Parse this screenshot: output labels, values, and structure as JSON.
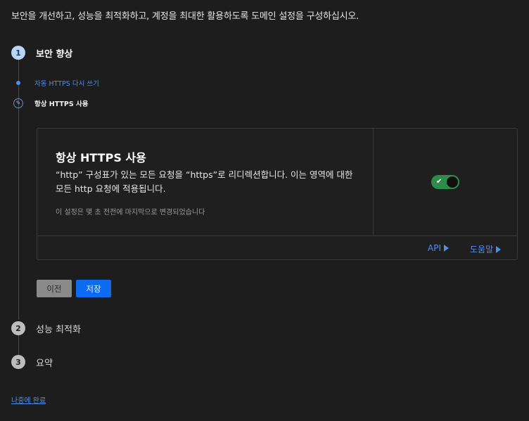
{
  "intro": "보안을 개선하고, 성능을 최적화하고, 계정을 최대한 활용하도록 도메인 설정을 구성하십시오.",
  "steps": [
    {
      "number": "1",
      "title": "보안 향상"
    },
    {
      "number": "2",
      "title": "성능 최적화"
    },
    {
      "number": "3",
      "title": "요약"
    }
  ],
  "substeps": [
    {
      "label": "자동 HTTPS 다시 쓰기"
    },
    {
      "label": "항상 HTTPS 사용"
    }
  ],
  "card": {
    "title": "항상 HTTPS 사용",
    "description": "“http” 구성표가 있는 모든 요청을 “https”로 리디렉션합니다. 이는 영역에 대한 모든 http 요청에 적용됩니다.",
    "meta": "이 설정은 몇 초 전전에 마지막으로 변경되었습니다",
    "toggle_on": true,
    "toggle_icon": "check-icon",
    "api_label": "API",
    "help_label": "도움말"
  },
  "buttons": {
    "prev": "이전",
    "save": "저장"
  },
  "later_link": "나중에 완료",
  "colors": {
    "accent": "#0a6cf2",
    "link": "#4d8ff0",
    "toggle_on": "#2e8b4a",
    "background": "#1d1d1d"
  }
}
